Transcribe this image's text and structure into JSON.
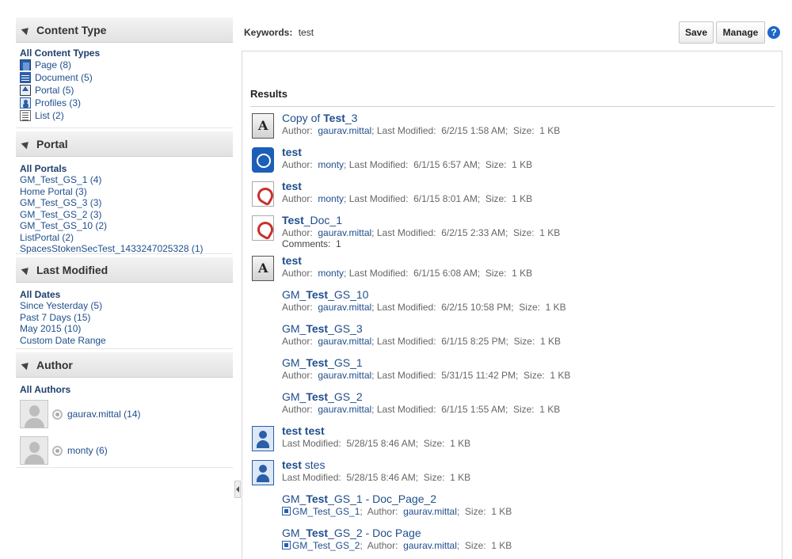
{
  "facets": {
    "content_type": {
      "heading": "Content Type",
      "all_label": "All Content Types",
      "items": [
        {
          "label": "Page",
          "count": "(8)",
          "icon": "page-icon"
        },
        {
          "label": "Document",
          "count": "(5)",
          "icon": "document-icon"
        },
        {
          "label": "Portal",
          "count": "(5)",
          "icon": "portal-icon"
        },
        {
          "label": "Profiles",
          "count": "(3)",
          "icon": "profile-icon"
        },
        {
          "label": "List",
          "count": "(2)",
          "icon": "list-icon"
        }
      ]
    },
    "portal": {
      "heading": "Portal",
      "all_label": "All Portals",
      "items": [
        {
          "label": "GM_Test_GS_1",
          "count": "(4)"
        },
        {
          "label": "Home Portal",
          "count": "(3)"
        },
        {
          "label": "GM_Test_GS_3",
          "count": "(3)"
        },
        {
          "label": "GM_Test_GS_2",
          "count": "(3)"
        },
        {
          "label": "GM_Test_GS_10",
          "count": "(2)"
        },
        {
          "label": "ListPortal",
          "count": "(2)"
        },
        {
          "label": "SpacesStokenSecTest_1433247025328",
          "count": "(1)"
        }
      ]
    },
    "last_modified": {
      "heading": "Last Modified",
      "all_label": "All Dates",
      "items": [
        {
          "label": "Since Yesterday",
          "count": "(5)"
        },
        {
          "label": "Past 7 Days",
          "count": "(15)"
        },
        {
          "label": "May 2015",
          "count": "(10)"
        },
        {
          "label": "Custom Date Range",
          "count": ""
        }
      ]
    },
    "author": {
      "heading": "Author",
      "all_label": "All Authors",
      "items": [
        {
          "label": "gaurav.mittal",
          "count": "(14)"
        },
        {
          "label": "monty",
          "count": "(6)"
        }
      ]
    }
  },
  "keywords": {
    "label": "Keywords:",
    "value": "test"
  },
  "buttons": {
    "save": "Save",
    "manage": "Manage",
    "help": "?"
  },
  "results": {
    "title": "Results",
    "items": [
      {
        "icon": "text-document-icon",
        "pre": "Copy of ",
        "bold": "Test",
        "post": "_3",
        "meta": [
          {
            "t": "Author:  "
          },
          {
            "t": "gaurav.mittal",
            "link": true
          },
          {
            "t": "; Last Modified:  6/2/15 1:58 AM;  Size:  1 KB"
          }
        ]
      },
      {
        "icon": "globe-icon",
        "pre": "",
        "bold": "test",
        "post": "",
        "meta": [
          {
            "t": "Author:  "
          },
          {
            "t": "monty",
            "link": true
          },
          {
            "t": "; Last Modified:  6/1/15 6:57 AM;  Size:  1 KB"
          }
        ]
      },
      {
        "icon": "pdf-icon",
        "pre": "",
        "bold": "test",
        "post": "",
        "meta": [
          {
            "t": "Author:  "
          },
          {
            "t": "monty",
            "link": true
          },
          {
            "t": "; Last Modified:  6/1/15 8:01 AM;  Size:  1 KB"
          }
        ]
      },
      {
        "icon": "pdf-icon",
        "pre": "",
        "bold": "Test",
        "post": "_Doc_1",
        "meta": [
          {
            "t": "Author:  "
          },
          {
            "t": "gaurav.mittal",
            "link": true
          },
          {
            "t": "; Last Modified:  6/2/15 2:33 AM;  Size:  1 KB"
          }
        ],
        "extra": "Comments:  1"
      },
      {
        "icon": "text-document-icon",
        "pre": "",
        "bold": "test",
        "post": "",
        "meta": [
          {
            "t": "Author:  "
          },
          {
            "t": "monty",
            "link": true
          },
          {
            "t": "; Last Modified:  6/1/15 6:08 AM;  Size:  1 KB"
          }
        ]
      },
      {
        "icon": "portal-page-icon",
        "pre": "GM_",
        "bold": "Test",
        "post": "_GS_10",
        "meta": [
          {
            "t": "Author:  "
          },
          {
            "t": "gaurav.mittal",
            "link": true
          },
          {
            "t": "; Last Modified:  6/2/15 10:58 PM;  Size:  1 KB"
          }
        ]
      },
      {
        "icon": "portal-page-icon",
        "pre": "GM_",
        "bold": "Test",
        "post": "_GS_3",
        "meta": [
          {
            "t": "Author:  "
          },
          {
            "t": "gaurav.mittal",
            "link": true
          },
          {
            "t": "; Last Modified:  6/1/15 8:25 PM;  Size:  1 KB"
          }
        ]
      },
      {
        "icon": "portal-page-icon",
        "pre": "GM_",
        "bold": "Test",
        "post": "_GS_1",
        "meta": [
          {
            "t": "Author:  "
          },
          {
            "t": "gaurav.mittal",
            "link": true
          },
          {
            "t": "; Last Modified:  5/31/15 11:42 PM;  Size:  1 KB"
          }
        ]
      },
      {
        "icon": "portal-page-icon",
        "pre": "GM_",
        "bold": "Test",
        "post": "_GS_2",
        "meta": [
          {
            "t": "Author:  "
          },
          {
            "t": "gaurav.mittal",
            "link": true
          },
          {
            "t": "; Last Modified:  6/1/15 1:55 AM;  Size:  1 KB"
          }
        ]
      },
      {
        "icon": "profile-icon",
        "pre": "",
        "bold": "test test",
        "post": "",
        "meta": [
          {
            "t": "Last Modified:  5/28/15 8:46 AM;  Size:  1 KB"
          }
        ]
      },
      {
        "icon": "profile-icon",
        "pre": "",
        "bold": "test",
        "post": " stes",
        "meta": [
          {
            "t": "Last Modified:  5/28/15 8:46 AM;  Size:  1 KB"
          }
        ]
      },
      {
        "icon": "document-pages-icon",
        "pre": "GM_",
        "bold": "Test",
        "post": "_GS_1 - Doc_Page_2",
        "meta": [
          {
            "t": "GM_Test_GS_1",
            "link": true,
            "mini": true
          },
          {
            "t": ";  Author:  "
          },
          {
            "t": "gaurav.mittal",
            "link": true
          },
          {
            "t": ";  Size:  1 KB"
          }
        ]
      },
      {
        "icon": "document-pages-icon",
        "pre": "GM_",
        "bold": "Test",
        "post": "_GS_2 - Doc Page",
        "meta": [
          {
            "t": "GM_Test_GS_2",
            "link": true,
            "mini": true
          },
          {
            "t": ";  Author:  "
          },
          {
            "t": "gaurav.mittal",
            "link": true
          },
          {
            "t": ";  Size:  1 KB"
          }
        ]
      }
    ]
  }
}
